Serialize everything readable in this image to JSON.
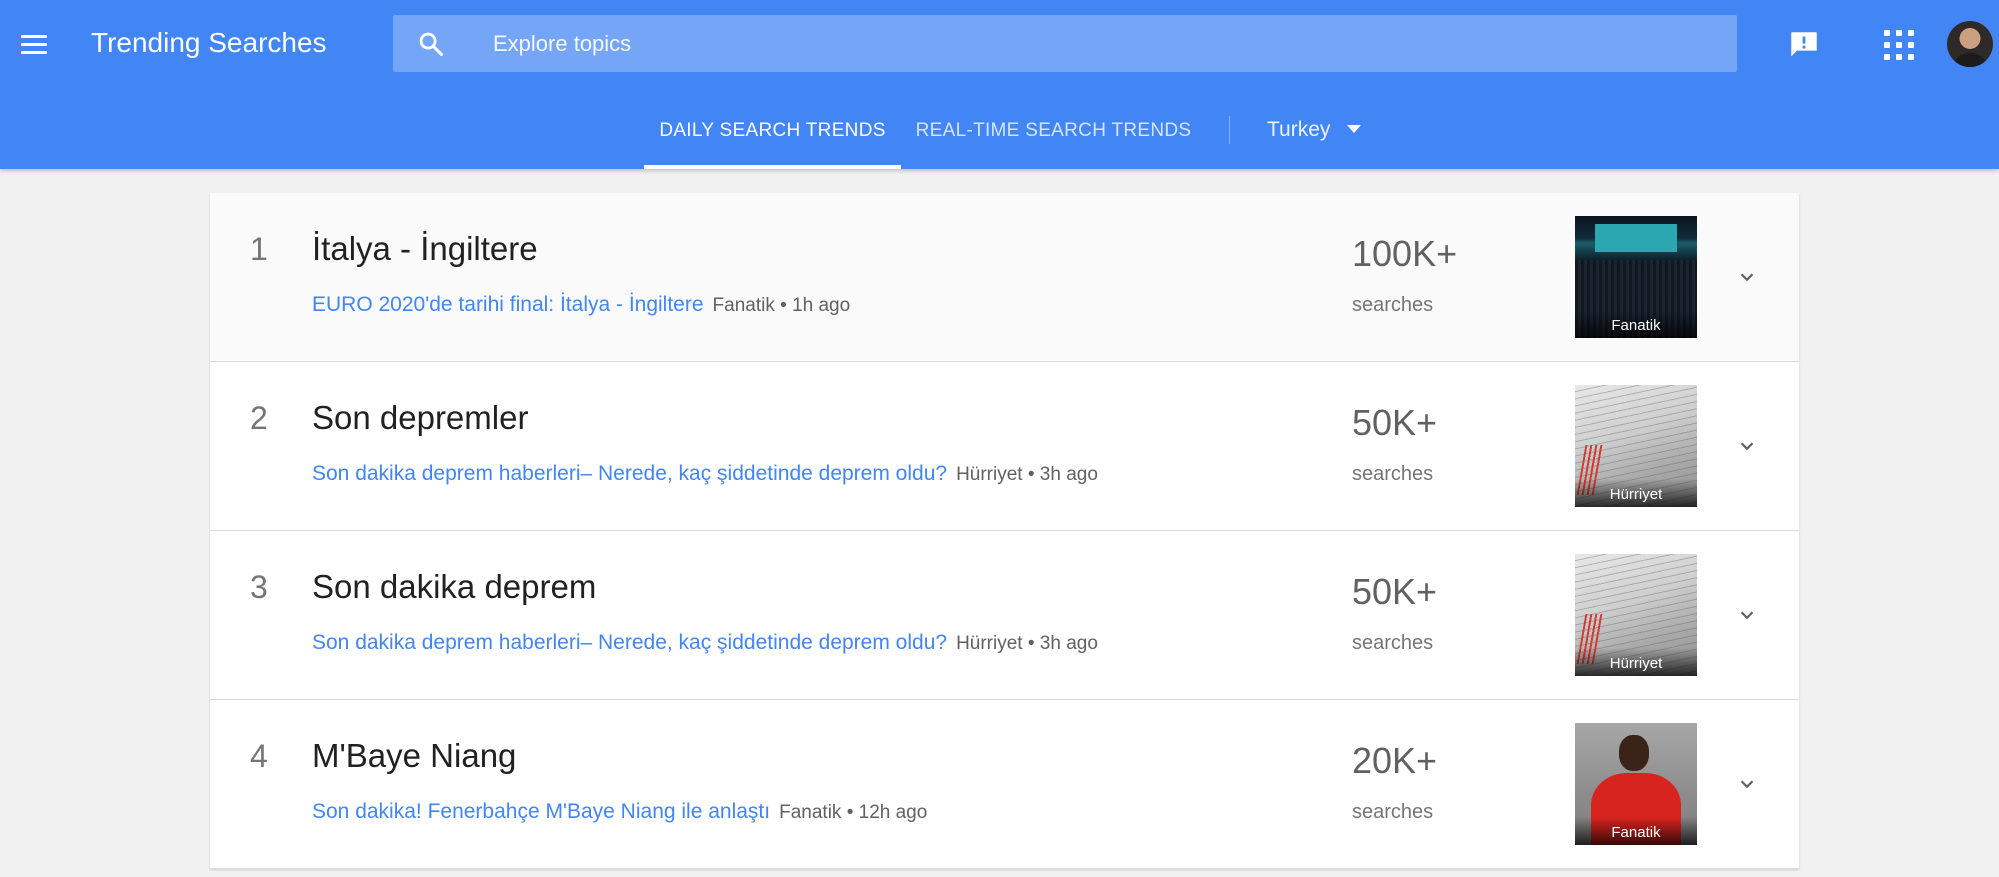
{
  "header": {
    "title": "Trending Searches",
    "search_placeholder": "Explore topics",
    "colors": {
      "brand": "#4285f4",
      "search_bg": "#75a5f7",
      "link": "#4285f4"
    },
    "icons": [
      "menu-icon",
      "search-icon",
      "feedback-icon",
      "apps-icon",
      "avatar"
    ]
  },
  "tabs": {
    "daily": "DAILY SEARCH TRENDS",
    "realtime": "REAL-TIME SEARCH TRENDS",
    "active": "daily"
  },
  "country": "Turkey",
  "trends": [
    {
      "rank": "1",
      "title": "İtalya - İngiltere",
      "article": "EURO 2020'de tarihi final: İtalya - İngiltere",
      "source": "Fanatik • 1h ago",
      "count": "100K+",
      "count_label": "searches",
      "image_source": "Fanatik"
    },
    {
      "rank": "2",
      "title": "Son depremler",
      "article": "Son dakika deprem haberleri– Nerede, kaç şiddetinde deprem oldu?",
      "source": "Hürriyet • 3h ago",
      "count": "50K+",
      "count_label": "searches",
      "image_source": "Hürriyet"
    },
    {
      "rank": "3",
      "title": "Son dakika deprem",
      "article": "Son dakika deprem haberleri– Nerede, kaç şiddetinde deprem oldu?",
      "source": "Hürriyet • 3h ago",
      "count": "50K+",
      "count_label": "searches",
      "image_source": "Hürriyet"
    },
    {
      "rank": "4",
      "title": "M'Baye Niang",
      "article": "Son dakika! Fenerbahçe M'Baye Niang ile anlaştı",
      "source": "Fanatik • 12h ago",
      "count": "20K+",
      "count_label": "searches",
      "image_source": "Fanatik"
    }
  ]
}
